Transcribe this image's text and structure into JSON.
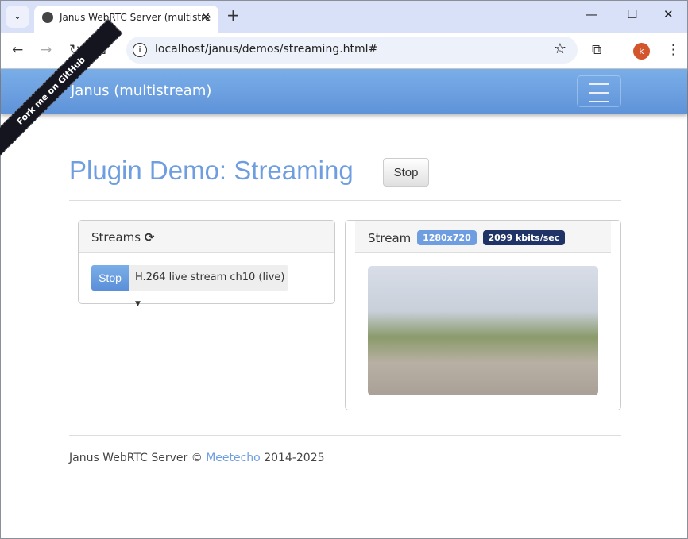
{
  "browser": {
    "tab_title": "Janus WebRTC Server (multistre",
    "url": "localhost/janus/demos/streaming.html#",
    "avatar_letter": "k"
  },
  "navbar": {
    "brand": "Janus (multistream)",
    "ribbon": "Fork me on GitHub"
  },
  "page": {
    "title": "Plugin Demo: Streaming",
    "stop_label": "Stop"
  },
  "streams_panel": {
    "title": "Streams",
    "stop_label": "Stop",
    "selected_stream": "H.264 live stream ch10 (live)"
  },
  "stream_panel": {
    "title": "Stream",
    "resolution": "1280x720",
    "bitrate": "2099 kbits/sec",
    "resolution_color": "#6f9ee0",
    "bitrate_color": "#1f3366"
  },
  "footer": {
    "prefix": "Janus WebRTC Server ©",
    "link": "Meetecho",
    "suffix": "2014-2025"
  }
}
